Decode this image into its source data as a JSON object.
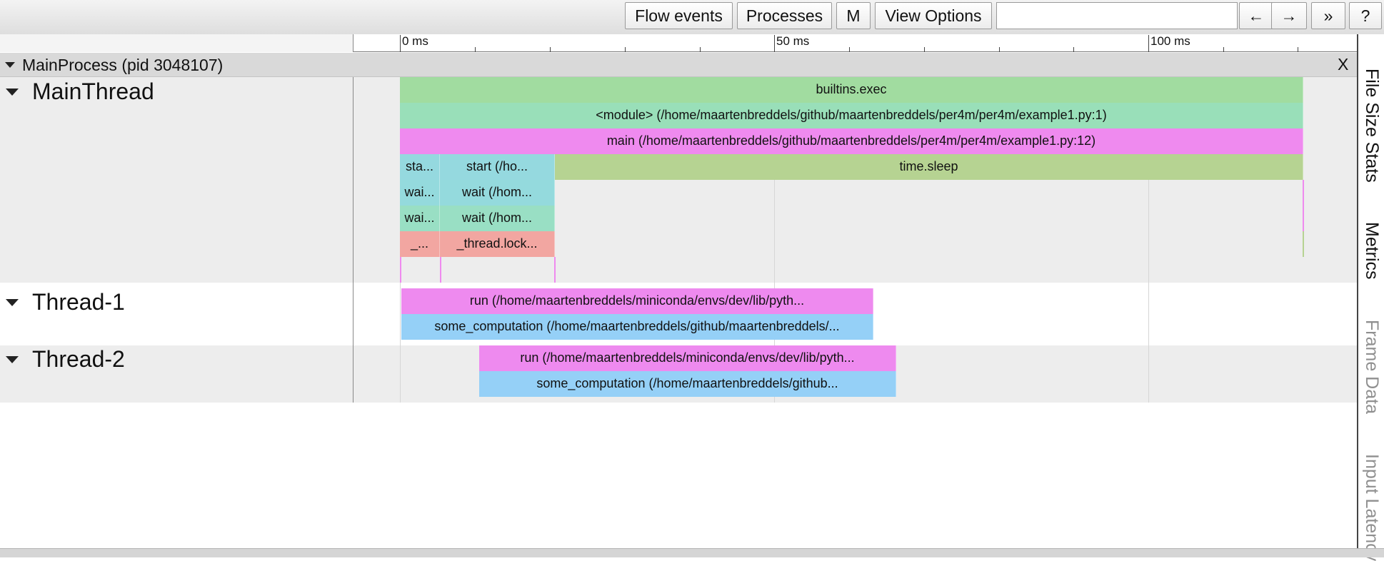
{
  "toolbar": {
    "flow_events": "Flow events",
    "processes": "Processes",
    "m": "M",
    "view_options": "View Options",
    "search_value": "",
    "prev": "←",
    "next": "→",
    "more": "»",
    "help": "?"
  },
  "ruler": {
    "ticks": [
      "0 ms",
      "50 ms",
      "100 ms"
    ]
  },
  "process": {
    "label": "MainProcess (pid 3048107)",
    "close": "X"
  },
  "threads": {
    "main": {
      "name": "MainThread",
      "slices": [
        {
          "label": "builtins.exec",
          "color": "#a1dca0"
        },
        {
          "label": "<module> (/home/maartenbreddels/github/maartenbreddels/per4m/per4m/example1.py:1)",
          "color": "#99dfb9"
        },
        {
          "label": "main (/home/maartenbreddels/github/maartenbreddels/per4m/per4m/example1.py:12)",
          "color": "#ef8aef"
        },
        {
          "label": "sta...",
          "color": "#95d9df"
        },
        {
          "label": "start (/ho...",
          "color": "#95d9df"
        },
        {
          "label": "time.sleep",
          "color": "#b6d392"
        },
        {
          "label": "wai...",
          "color": "#94dadd"
        },
        {
          "label": "wait (/hom...",
          "color": "#94dadd"
        },
        {
          "label": "wai...",
          "color": "#99dfc4"
        },
        {
          "label": "wait (/hom...",
          "color": "#99dfc4"
        },
        {
          "label": "_...",
          "color": "#f2a6a1"
        },
        {
          "label": "_thread.lock...",
          "color": "#f2a6a1"
        }
      ]
    },
    "t1": {
      "name": "Thread-1",
      "slices": [
        {
          "label": "run (/home/maartenbreddels/miniconda/envs/dev/lib/pyth...",
          "color": "#ee8aef"
        },
        {
          "label": "some_computation (/home/maartenbreddels/github/maartenbreddels/...",
          "color": "#95d0f7"
        }
      ]
    },
    "t2": {
      "name": "Thread-2",
      "slices": [
        {
          "label": "run (/home/maartenbreddels/miniconda/envs/dev/lib/pyth...",
          "color": "#ee8aef"
        },
        {
          "label": "some_computation (/home/maartenbreddels/github...",
          "color": "#95d0f7"
        }
      ]
    }
  },
  "side_tabs": [
    {
      "label": "File Size Stats",
      "active": true
    },
    {
      "label": "Metrics",
      "active": true
    },
    {
      "label": "Frame Data",
      "active": false
    },
    {
      "label": "Input Latency",
      "active": false
    }
  ]
}
